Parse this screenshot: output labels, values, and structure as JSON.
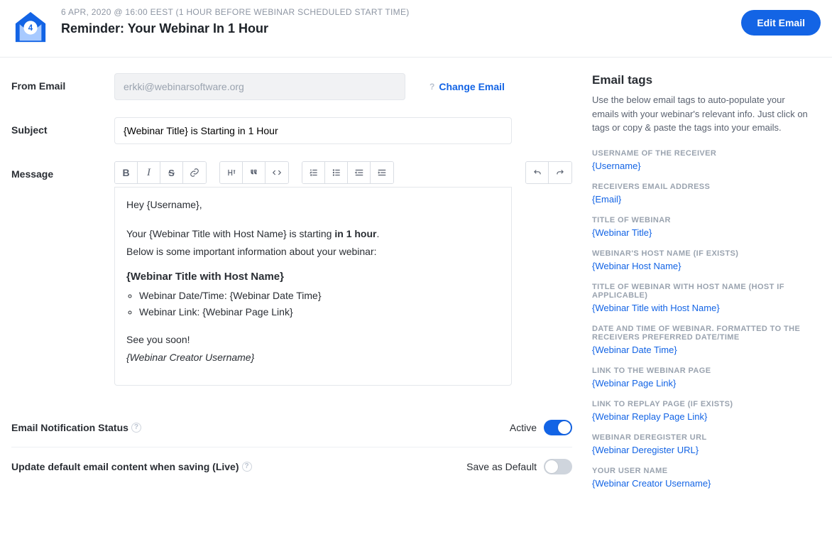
{
  "header": {
    "timestamp": "6 APR, 2020 @ 16:00 EEST (1 HOUR BEFORE WEBINAR SCHEDULED START TIME)",
    "title": "Reminder: Your Webinar In 1 Hour",
    "edit_button": "Edit Email",
    "badge_number": "4"
  },
  "form": {
    "from_label": "From Email",
    "from_value": "erkki@webinarsoftware.org",
    "change_email": "Change Email",
    "subject_label": "Subject",
    "subject_value": "{Webinar Title} is Starting in 1 Hour",
    "message_label": "Message"
  },
  "message": {
    "greeting": "Hey {Username},",
    "line1_a": "Your {Webinar Title with Host Name} is starting ",
    "line1_b": "in 1 hour",
    "line1_c": ".",
    "line2": "Below is some important information about your webinar:",
    "heading": "{Webinar Title with Host Name}",
    "bullet1": "Webinar Date/Time: {Webinar Date Time}",
    "bullet2": "Webinar Link: {Webinar Page Link}",
    "signoff1": "See you soon!",
    "signoff2": "{Webinar Creator Username}"
  },
  "settings": {
    "status_label": "Email Notification Status",
    "status_value": "Active",
    "default_label": "Update default email content when saving (Live)",
    "default_value": "Save as Default"
  },
  "sidebar": {
    "title": "Email tags",
    "desc": "Use the below email tags to auto-populate your emails with your webinar's relevant info. Just click on tags or copy & paste the tags into your emails.",
    "tags": [
      {
        "label": "USERNAME OF THE RECEIVER",
        "value": "{Username}"
      },
      {
        "label": "RECEIVERS EMAIL ADDRESS",
        "value": "{Email}"
      },
      {
        "label": "TITLE OF WEBINAR",
        "value": "{Webinar Title}"
      },
      {
        "label": "WEBINAR'S HOST NAME (IF EXISTS)",
        "value": "{Webinar Host Name}"
      },
      {
        "label": "TITLE OF WEBINAR WITH HOST NAME (HOST IF APPLICABLE)",
        "value": "{Webinar Title with Host Name}"
      },
      {
        "label": "DATE AND TIME OF WEBINAR. FORMATTED TO THE RECEIVERS PREFERRED DATE/TIME",
        "value": "{Webinar Date Time}"
      },
      {
        "label": "LINK TO THE WEBINAR PAGE",
        "value": "{Webinar Page Link}"
      },
      {
        "label": "LINK TO REPLAY PAGE (IF EXISTS)",
        "value": "{Webinar Replay Page Link}"
      },
      {
        "label": "WEBINAR DEREGISTER URL",
        "value": "{Webinar Deregister URL}"
      },
      {
        "label": "YOUR USER NAME",
        "value": "{Webinar Creator Username}"
      }
    ]
  }
}
